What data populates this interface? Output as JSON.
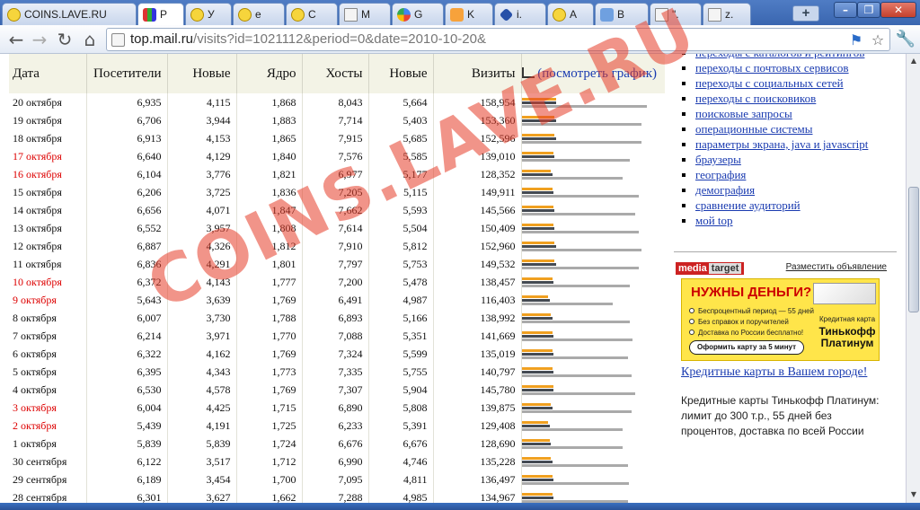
{
  "browser": {
    "tabs": [
      {
        "label": "COINS.LAVE.RU",
        "icon": "smile",
        "active": false
      },
      {
        "label": "Р",
        "icon": "chart",
        "active": true
      },
      {
        "label": "У",
        "icon": "smile",
        "active": false
      },
      {
        "label": "е",
        "icon": "smile",
        "active": false
      },
      {
        "label": "С",
        "icon": "smile",
        "active": false
      },
      {
        "label": "М",
        "icon": "page",
        "active": false
      },
      {
        "label": "G",
        "icon": "g",
        "active": false
      },
      {
        "label": "K",
        "icon": "k",
        "active": false
      },
      {
        "label": "i.",
        "icon": "i",
        "active": false
      },
      {
        "label": "А",
        "icon": "smile",
        "active": false
      },
      {
        "label": "В",
        "icon": "home",
        "active": false
      },
      {
        "label": "\".",
        "icon": "page",
        "active": false
      },
      {
        "label": "z.",
        "icon": "page",
        "active": false
      }
    ],
    "new_tab_label": "+",
    "url_host": "top.mail.ru",
    "url_path": "/visits?id=1021112&period=0&date=2010-10-20&"
  },
  "table": {
    "headers": {
      "date": "Дата",
      "visitors": "Посетители",
      "new1": "Новые",
      "core": "Ядро",
      "hosts": "Хосты",
      "new2": "Новые",
      "visits": "Визиты",
      "graph_link": "(посмотреть график)"
    },
    "rows": [
      {
        "date": "20 октября",
        "weekend": false,
        "visitors": "6,935",
        "new1": "4,115",
        "core": "1,868",
        "hosts": "8,043",
        "new2": "5,664",
        "visits": "158,954",
        "b1": 0.27,
        "b2": 0.27,
        "b3": 0.99
      },
      {
        "date": "19 октября",
        "weekend": false,
        "visitors": "6,706",
        "new1": "3,944",
        "core": "1,883",
        "hosts": "7,714",
        "new2": "5,403",
        "visits": "153,360",
        "b1": 0.26,
        "b2": 0.27,
        "b3": 0.95
      },
      {
        "date": "18 октября",
        "weekend": false,
        "visitors": "6,913",
        "new1": "4,153",
        "core": "1,865",
        "hosts": "7,915",
        "new2": "5,685",
        "visits": "152,596",
        "b1": 0.26,
        "b2": 0.27,
        "b3": 0.95
      },
      {
        "date": "17 октября",
        "weekend": true,
        "visitors": "6,640",
        "new1": "4,129",
        "core": "1,840",
        "hosts": "7,576",
        "new2": "5,585",
        "visits": "139,010",
        "b1": 0.25,
        "b2": 0.26,
        "b3": 0.86
      },
      {
        "date": "16 октября",
        "weekend": true,
        "visitors": "6,104",
        "new1": "3,776",
        "core": "1,821",
        "hosts": "6,977",
        "new2": "5,177",
        "visits": "128,352",
        "b1": 0.23,
        "b2": 0.24,
        "b3": 0.8
      },
      {
        "date": "15 октября",
        "weekend": false,
        "visitors": "6,206",
        "new1": "3,725",
        "core": "1,836",
        "hosts": "7,205",
        "new2": "5,115",
        "visits": "149,911",
        "b1": 0.24,
        "b2": 0.25,
        "b3": 0.93
      },
      {
        "date": "14 октября",
        "weekend": false,
        "visitors": "6,656",
        "new1": "4,071",
        "core": "1,847",
        "hosts": "7,662",
        "new2": "5,593",
        "visits": "145,566",
        "b1": 0.25,
        "b2": 0.26,
        "b3": 0.9
      },
      {
        "date": "13 октября",
        "weekend": false,
        "visitors": "6,552",
        "new1": "3,957",
        "core": "1,808",
        "hosts": "7,614",
        "new2": "5,504",
        "visits": "150,409",
        "b1": 0.25,
        "b2": 0.26,
        "b3": 0.93
      },
      {
        "date": "12 октября",
        "weekend": false,
        "visitors": "6,887",
        "new1": "4,326",
        "core": "1,812",
        "hosts": "7,910",
        "new2": "5,812",
        "visits": "152,960",
        "b1": 0.26,
        "b2": 0.27,
        "b3": 0.95
      },
      {
        "date": "11 октября",
        "weekend": false,
        "visitors": "6,836",
        "new1": "4,291",
        "core": "1,801",
        "hosts": "7,797",
        "new2": "5,753",
        "visits": "149,532",
        "b1": 0.26,
        "b2": 0.27,
        "b3": 0.93
      },
      {
        "date": "10 октября",
        "weekend": true,
        "visitors": "6,372",
        "new1": "4,143",
        "core": "1,777",
        "hosts": "7,200",
        "new2": "5,478",
        "visits": "138,457",
        "b1": 0.24,
        "b2": 0.25,
        "b3": 0.86
      },
      {
        "date": "9 октября",
        "weekend": true,
        "visitors": "5,643",
        "new1": "3,639",
        "core": "1,769",
        "hosts": "6,491",
        "new2": "4,987",
        "visits": "116,403",
        "b1": 0.21,
        "b2": 0.22,
        "b3": 0.72
      },
      {
        "date": "8 октября",
        "weekend": false,
        "visitors": "6,007",
        "new1": "3,730",
        "core": "1,788",
        "hosts": "6,893",
        "new2": "5,166",
        "visits": "138,992",
        "b1": 0.23,
        "b2": 0.24,
        "b3": 0.86
      },
      {
        "date": "7 октября",
        "weekend": false,
        "visitors": "6,214",
        "new1": "3,971",
        "core": "1,770",
        "hosts": "7,088",
        "new2": "5,351",
        "visits": "141,669",
        "b1": 0.24,
        "b2": 0.25,
        "b3": 0.88
      },
      {
        "date": "6 октября",
        "weekend": false,
        "visitors": "6,322",
        "new1": "4,162",
        "core": "1,769",
        "hosts": "7,324",
        "new2": "5,599",
        "visits": "135,019",
        "b1": 0.24,
        "b2": 0.25,
        "b3": 0.84
      },
      {
        "date": "5 октября",
        "weekend": false,
        "visitors": "6,395",
        "new1": "4,343",
        "core": "1,773",
        "hosts": "7,335",
        "new2": "5,755",
        "visits": "140,797",
        "b1": 0.24,
        "b2": 0.25,
        "b3": 0.87
      },
      {
        "date": "4 октября",
        "weekend": false,
        "visitors": "6,530",
        "new1": "4,578",
        "core": "1,769",
        "hosts": "7,307",
        "new2": "5,904",
        "visits": "145,780",
        "b1": 0.25,
        "b2": 0.25,
        "b3": 0.9
      },
      {
        "date": "3 октября",
        "weekend": true,
        "visitors": "6,004",
        "new1": "4,425",
        "core": "1,715",
        "hosts": "6,890",
        "new2": "5,808",
        "visits": "139,875",
        "b1": 0.23,
        "b2": 0.24,
        "b3": 0.87
      },
      {
        "date": "2 октября",
        "weekend": true,
        "visitors": "5,439",
        "new1": "4,191",
        "core": "1,725",
        "hosts": "6,233",
        "new2": "5,391",
        "visits": "129,408",
        "b1": 0.21,
        "b2": 0.22,
        "b3": 0.8
      },
      {
        "date": "1 октября",
        "weekend": false,
        "visitors": "5,839",
        "new1": "5,839",
        "core": "1,724",
        "hosts": "6,676",
        "new2": "6,676",
        "visits": "128,690",
        "b1": 0.22,
        "b2": 0.23,
        "b3": 0.8
      },
      {
        "date": "30 сентября",
        "weekend": false,
        "visitors": "6,122",
        "new1": "3,517",
        "core": "1,712",
        "hosts": "6,990",
        "new2": "4,746",
        "visits": "135,228",
        "b1": 0.23,
        "b2": 0.24,
        "b3": 0.84
      },
      {
        "date": "29 сентября",
        "weekend": false,
        "visitors": "6,189",
        "new1": "3,454",
        "core": "1,700",
        "hosts": "7,095",
        "new2": "4,811",
        "visits": "136,497",
        "b1": 0.24,
        "b2": 0.25,
        "b3": 0.85
      },
      {
        "date": "28 сентября",
        "weekend": false,
        "visitors": "6,301",
        "new1": "3,627",
        "core": "1,662",
        "hosts": "7,288",
        "new2": "4,985",
        "visits": "134,967",
        "b1": 0.24,
        "b2": 0.25,
        "b3": 0.84
      }
    ]
  },
  "sidenav": {
    "items": [
      "переходы с каталогов и рейтингов",
      "переходы с почтовых сервисов",
      "переходы с социальных сетей",
      "переходы с поисковиков",
      "поисковые запросы",
      "операционные системы",
      "параметры экрана, java и javascript",
      "браузеры",
      "география",
      "демография",
      "сравнение аудиторий",
      "мой top"
    ]
  },
  "ad": {
    "logo_left": "media",
    "logo_right": "target",
    "place_link": "Разместить объявление",
    "banner_title": "НУЖНЫ ДЕНЬГИ?",
    "banner_lines": [
      "Беспроцентный период — 55 дней",
      "Без справок и поручителей",
      "Доставка по России бесплатно!"
    ],
    "banner_brand": "Кредитная карта",
    "banner_name": "Тинькофф Платинум",
    "banner_button": "Оформить карту за 5 минут",
    "link_text": "Кредитные карты в Вашем городе!",
    "body_text": "Кредитные карты Тинькофф Платинум: лимит до 300 т.р., 55 дней без процентов, доставка по всей России"
  },
  "watermark": "COINS.LAVE.RU",
  "colors": {
    "bar_orange": "#f0a020",
    "bar_dark": "#444a52",
    "bar_gray": "#aaaaaa",
    "weekend_red": "#dd0000",
    "link_blue": "#1a3bb0"
  }
}
